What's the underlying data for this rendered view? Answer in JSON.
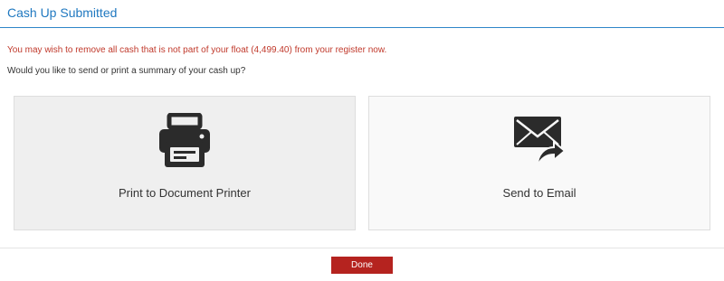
{
  "dialog": {
    "title": "Cash Up Submitted",
    "warning": "You may wish to remove all cash that is not part of your float (4,499.40) from your register now.",
    "question": "Would you like to send or print a summary of your cash up?"
  },
  "options": {
    "print": {
      "label": "Print to Document Printer",
      "icon": "printer-icon"
    },
    "email": {
      "label": "Send to Email",
      "icon": "envelope-send-icon"
    }
  },
  "footer": {
    "done_label": "Done"
  },
  "colors": {
    "title": "#1f78c0",
    "warning": "#c0392b",
    "done_button": "#b5231f",
    "icon": "#2b2b2b"
  }
}
